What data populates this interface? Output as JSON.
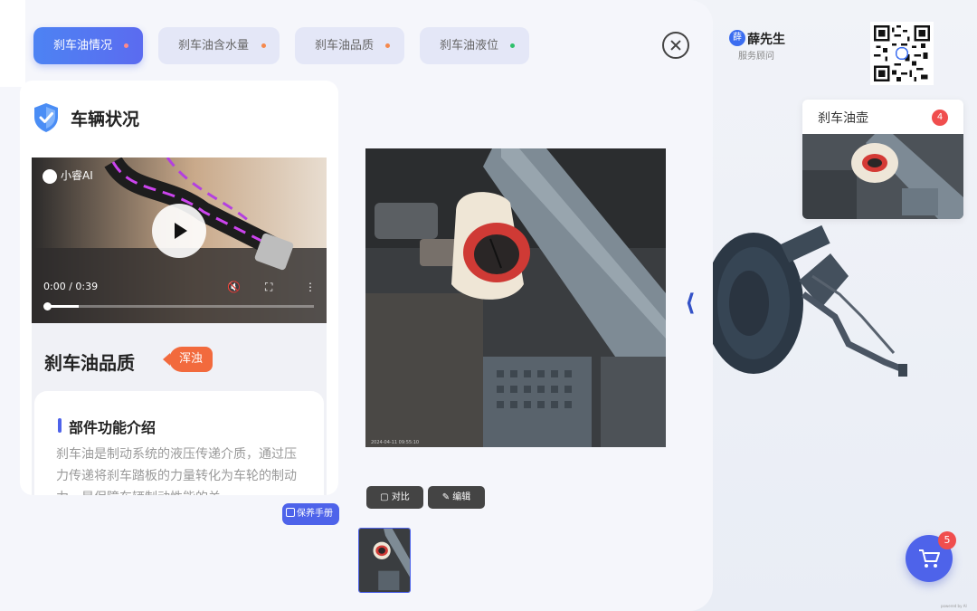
{
  "tabs": [
    {
      "label": "刹车油情况",
      "active": true,
      "dot_color": "#f56c6c"
    },
    {
      "label": "刹车油含水量",
      "active": false,
      "dot_color": "#f5894d"
    },
    {
      "label": "刹车油品质",
      "active": false,
      "dot_color": "#f5894d"
    },
    {
      "label": "刹车油液位",
      "active": false,
      "dot_color": "#2ec06b"
    }
  ],
  "status_card": {
    "heading": "车辆状况",
    "video": {
      "brand": "小睿AI",
      "time": "0:00 / 0:39",
      "progress": 0.12
    },
    "quality_title": "刹车油品质",
    "quality_tag": "浑浊",
    "intro": {
      "title": "部件功能介绍",
      "body": "刹车油是制动系统的液压传递介质，通过压力传递将刹车踏板的力量转化为车轮的制动力，是保障车辆制动性能的关"
    }
  },
  "manual_label": "保养手册",
  "toolbar": {
    "compare_label": "对比",
    "edit_label": "编辑"
  },
  "advisor": {
    "avatar_text": "薛",
    "name": "薛先生",
    "role": "服务顾问"
  },
  "part_card": {
    "title": "刹车油壶",
    "count": "4"
  },
  "cart": {
    "count": "5"
  },
  "photo_stamp": "2024-04-11 09:55:10",
  "watermark": "powered by AI"
}
